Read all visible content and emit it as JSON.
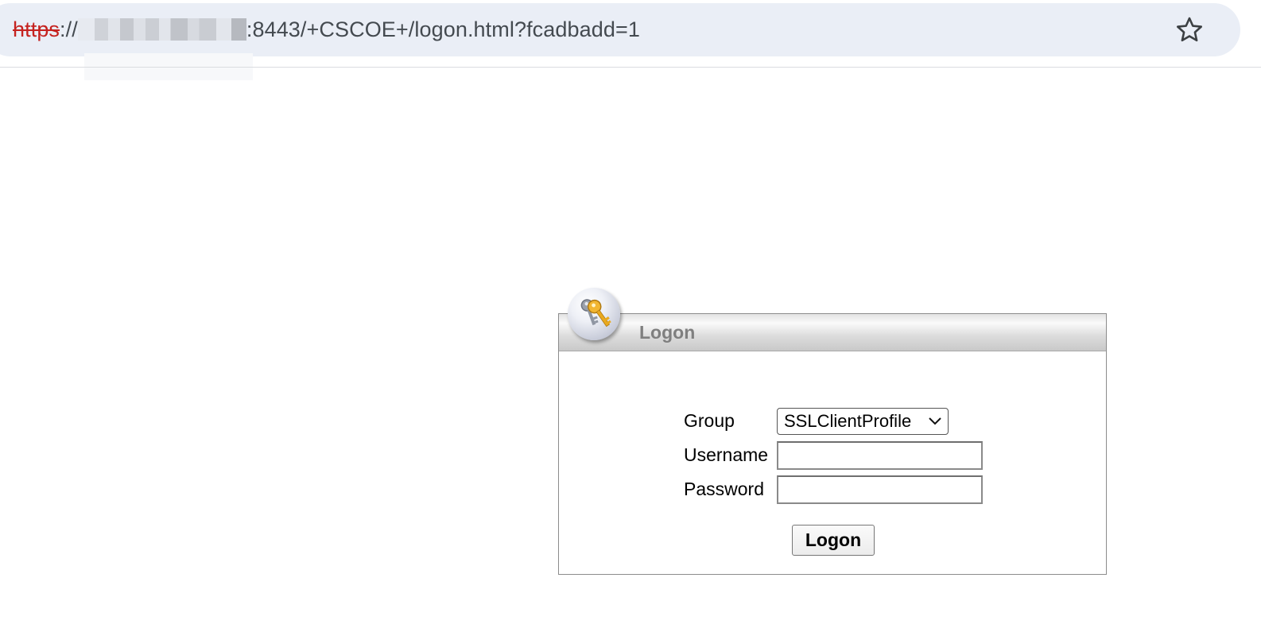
{
  "browser": {
    "url_scheme": "https",
    "url_separator": "://",
    "url_rest": ":8443/+CSCOE+/logon.html?fcadbadd=1",
    "bookmark_icon": "star-outline-icon"
  },
  "logon_panel": {
    "title": "Logon",
    "badge_icon": "keys-icon",
    "group_label": "Group",
    "group_selected": "SSLClientProfile",
    "username_label": "Username",
    "username_value": "",
    "password_label": "Password",
    "password_value": "",
    "submit_label": "Logon"
  },
  "colors": {
    "insecure_scheme": "#c5221f",
    "address_bar_bg": "#eaeef6",
    "panel_title": "#7f7f7f"
  }
}
